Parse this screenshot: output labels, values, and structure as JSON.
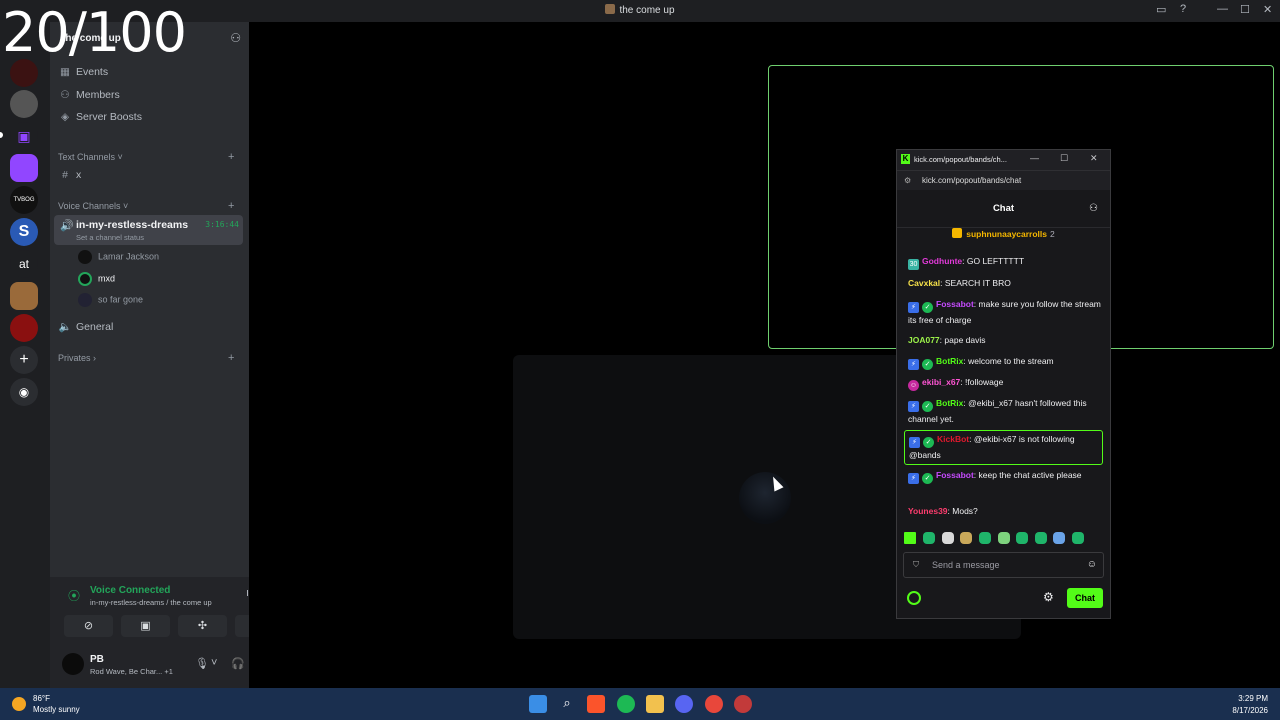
{
  "counter": "20/100",
  "window": {
    "title": "the come up"
  },
  "server": {
    "name": "the come up"
  },
  "nav": [
    {
      "label": "Events",
      "icon": "calendar-icon"
    },
    {
      "label": "Members",
      "icon": "members-icon"
    },
    {
      "label": "Server Boosts",
      "icon": "boost-icon"
    }
  ],
  "text_channels": {
    "category": "Text Channels",
    "channels": [
      {
        "name": "x"
      }
    ]
  },
  "voice_channels": {
    "category": "Voice Channels",
    "active": {
      "name": "in-my-restless-dreams",
      "timer": "3:16:44",
      "status": "Set a channel status",
      "users": [
        "Lamar Jackson",
        "mxd",
        "so far gone"
      ]
    },
    "other": "General"
  },
  "privates_category": "Privates",
  "voice_panel": {
    "status": "Voice Connected",
    "location": "in-my-restless-dreams / the come up"
  },
  "user": {
    "name": "PB",
    "activity": "Rod Wave, Be Char... +1"
  },
  "kick": {
    "window_title": "kick.com/popout/bands/ch...",
    "url": "kick.com/popout/bands/chat",
    "header": "Chat",
    "pinned": {
      "user": "suphnunaaycarrolls",
      "count": "2"
    },
    "messages": [
      {
        "user": "Godhunte",
        "text": "GO LEFTTTTT",
        "color": "#e23ad9"
      },
      {
        "user": "Cavxkal",
        "text": "SEARCH IT BRO",
        "color": "#f5e04a"
      },
      {
        "user": "Fossabot",
        "text": "make sure you follow the stream its free of charge",
        "color": "#c64bff"
      },
      {
        "user": "JOA077",
        "text": "pape davis",
        "color": "#9cf24a"
      },
      {
        "user": "BotRix",
        "text": "welcome to the stream",
        "color": "#53fc18"
      },
      {
        "user": "ekibi_x67",
        "text": "!followage",
        "color": "#ff55d4"
      },
      {
        "user": "BotRix",
        "text": "@ekibi_x67 hasn't followed this channel yet.",
        "color": "#53fc18"
      },
      {
        "user": "KickBot",
        "text": "@ekibi-x67 is not following @bands",
        "color": "#e0182d"
      },
      {
        "user": "Fossabot",
        "text": "keep the chat active please",
        "color": "#c64bff"
      },
      {
        "user": "Younes39",
        "text": "Mods?",
        "color": "#ff3d6e"
      }
    ],
    "input_placeholder": "Send a message",
    "send_label": "Chat"
  },
  "taskbar": {
    "temp": "86°F",
    "condition": "Mostly sunny",
    "time": "3:29 PM",
    "date": "8/17/2026"
  }
}
